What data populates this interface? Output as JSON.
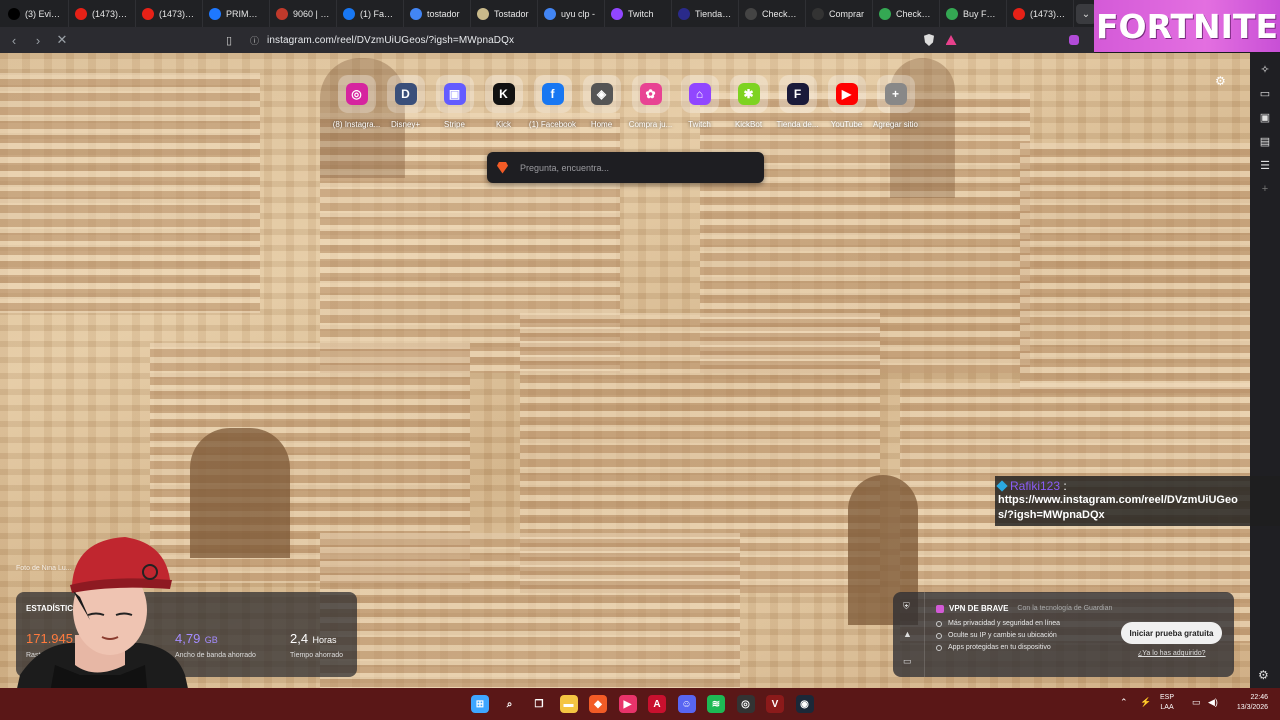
{
  "tabs": [
    {
      "title": "(3) Evil m",
      "icon": "x-icon",
      "color": "#000000"
    },
    {
      "title": "(1473) PE",
      "icon": "youtube-icon",
      "color": "#e62117"
    },
    {
      "title": "(1473) CA",
      "icon": "youtube-icon",
      "color": "#e62117"
    },
    {
      "title": "PRIME AT",
      "icon": "prime-icon",
      "color": "#1e78ff"
    },
    {
      "title": "9060 | Bú",
      "icon": "store-icon",
      "color": "#c0392b"
    },
    {
      "title": "(1) Facebo",
      "icon": "facebook-icon",
      "color": "#1877f2"
    },
    {
      "title": "tostador",
      "icon": "google-icon",
      "color": "#4285f4"
    },
    {
      "title": "Tostador",
      "icon": "store-icon",
      "color": "#c9b98a"
    },
    {
      "title": "uyu clp -",
      "icon": "google-icon",
      "color": "#4285f4"
    },
    {
      "title": "Twitch",
      "icon": "twitch-icon",
      "color": "#9146ff"
    },
    {
      "title": "Tienda de",
      "icon": "fortnite-icon",
      "color": "#2a2a8a"
    },
    {
      "title": "Checkout",
      "icon": "checkout-icon",
      "color": "#444444"
    },
    {
      "title": "Comprar",
      "icon": "epic-icon",
      "color": "#333333"
    },
    {
      "title": "Checkout",
      "icon": "chrome-icon",
      "color": "#34a853"
    },
    {
      "title": "Buy Fortn",
      "icon": "chrome-icon",
      "color": "#34a853"
    },
    {
      "title": "(1473) Es",
      "icon": "youtube-icon",
      "color": "#e62117"
    }
  ],
  "overlay_banner": {
    "text": "FORTNITE"
  },
  "address_bar": {
    "url": "instagram.com/reel/DVzmUiUGeos/?igsh=MWpnaDQx"
  },
  "shortcuts": [
    {
      "label": "(8) Instagra...",
      "icon": "instagram-icon",
      "color": "#d6249f",
      "glyph": "◎"
    },
    {
      "label": "Disney+",
      "icon": "disney-icon",
      "color": "#3a4f7a",
      "glyph": "D"
    },
    {
      "label": "Stripe",
      "icon": "stripe-icon",
      "color": "#635bff",
      "glyph": "▣"
    },
    {
      "label": "Kick",
      "icon": "kick-icon",
      "color": "#111111",
      "glyph": "K"
    },
    {
      "label": "(1) Facebook",
      "icon": "facebook-icon",
      "color": "#1877f2",
      "glyph": "f"
    },
    {
      "label": "Home",
      "icon": "home-icon",
      "color": "#555555",
      "glyph": "◈"
    },
    {
      "label": "Compra ju...",
      "icon": "pinwheel-icon",
      "color": "#e84393",
      "glyph": "✿"
    },
    {
      "label": "Twitch",
      "icon": "twitch-icon",
      "color": "#9146ff",
      "glyph": "⌂"
    },
    {
      "label": "KickBot",
      "icon": "kickbot-icon",
      "color": "#7ed321",
      "glyph": "✱"
    },
    {
      "label": "Tienda de...",
      "icon": "fortnite-icon",
      "color": "#1a1a3a",
      "glyph": "F"
    },
    {
      "label": "YouTube",
      "icon": "youtube-icon",
      "color": "#ff0000",
      "glyph": "▶"
    },
    {
      "label": "Agregar sitio",
      "icon": "plus-icon",
      "color": "#888888",
      "glyph": "+"
    }
  ],
  "search": {
    "placeholder": "Pregunta, encuentra..."
  },
  "chat": {
    "username": "Rafiki123",
    "colon": ":",
    "message": "https://www.instagram.com/reel/DVzmUiUGeos/?igsh=MWpnaDQx"
  },
  "photo_credit": "Foto de Nina Lu...",
  "stats": {
    "title": "ESTADÍSTICAS",
    "trackers": {
      "value": "171.945",
      "label": "Rastreadores",
      "color": "#ff7a3d"
    },
    "bandwidth": {
      "value": "4,79",
      "unit": "GB",
      "label": "Ancho de banda ahorrado",
      "color": "#a48cff"
    },
    "time": {
      "value": "2,4",
      "unit": "Horas",
      "label": "Tiempo ahorrado",
      "color": "#ffffff"
    }
  },
  "vpn": {
    "title": "VPN DE BRAVE",
    "powered": "Con la tecnología de  Guardian",
    "features": [
      "Más privacidad y seguridad en línea",
      "Oculte su IP y cambie su ubicación",
      "Apps protegidas en tu dispositivo"
    ],
    "cta": "Iniciar prueba gratuita",
    "link": "¿Ya lo has adquirido?"
  },
  "taskbar": {
    "apps": [
      {
        "icon": "windows-start-icon",
        "color": "#3ea6ff",
        "glyph": "⊞"
      },
      {
        "icon": "search-icon",
        "color": "transparent",
        "glyph": "⌕"
      },
      {
        "icon": "task-view-icon",
        "color": "transparent",
        "glyph": "❐"
      },
      {
        "icon": "file-explorer-icon",
        "color": "#f4c542",
        "glyph": "▬"
      },
      {
        "icon": "brave-icon",
        "color": "#f25b26",
        "glyph": "◆"
      },
      {
        "icon": "media-player-icon",
        "color": "#e8336a",
        "glyph": "▶"
      },
      {
        "icon": "adobe-icon",
        "color": "#c8102e",
        "glyph": "A"
      },
      {
        "icon": "discord-icon",
        "color": "#5865f2",
        "glyph": "☺"
      },
      {
        "icon": "spotify-icon",
        "color": "#1db954",
        "glyph": "≋"
      },
      {
        "icon": "obs-icon",
        "color": "#333333",
        "glyph": "◎"
      },
      {
        "icon": "valorant-icon",
        "color": "#8b1a1a",
        "glyph": "V"
      },
      {
        "icon": "steam-icon",
        "color": "#1b2838",
        "glyph": "◉"
      }
    ],
    "lang_line1": "ESP",
    "lang_line2": "LAA",
    "time": "22:46",
    "date": "13/3/2026"
  }
}
